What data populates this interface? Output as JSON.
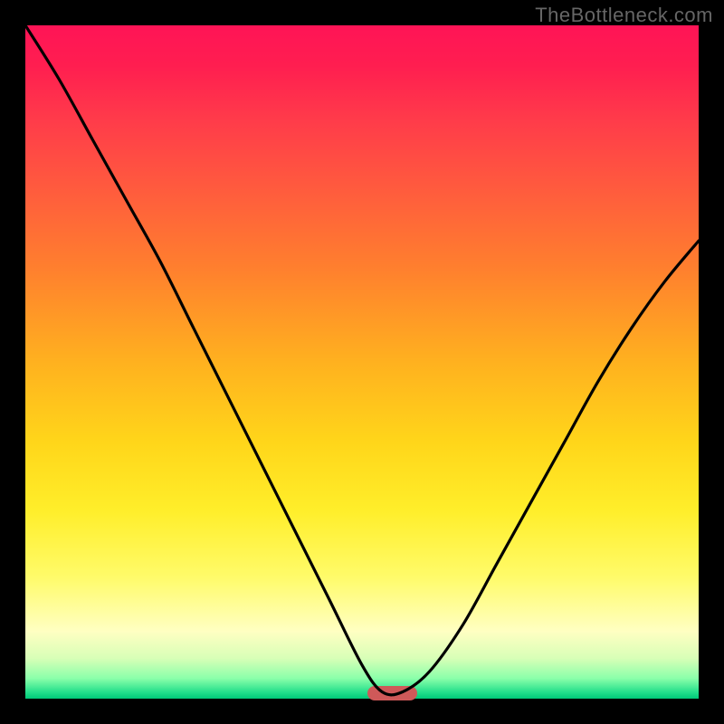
{
  "watermark": "TheBottleneck.com",
  "colors": {
    "frame_bg": "#000000",
    "marker": "#cf5959",
    "curve": "#000000"
  },
  "chart_data": {
    "type": "line",
    "title": "",
    "xlabel": "",
    "ylabel": "",
    "xlim": [
      0,
      1
    ],
    "ylim": [
      0,
      1
    ],
    "series": [
      {
        "name": "bottleneck-curve",
        "x": [
          0.0,
          0.05,
          0.1,
          0.15,
          0.2,
          0.25,
          0.3,
          0.35,
          0.4,
          0.45,
          0.5,
          0.53,
          0.56,
          0.6,
          0.65,
          0.7,
          0.75,
          0.8,
          0.85,
          0.9,
          0.95,
          1.0
        ],
        "y": [
          1.0,
          0.92,
          0.83,
          0.74,
          0.65,
          0.55,
          0.45,
          0.35,
          0.25,
          0.15,
          0.05,
          0.01,
          0.01,
          0.04,
          0.11,
          0.2,
          0.29,
          0.38,
          0.47,
          0.55,
          0.62,
          0.68
        ]
      }
    ],
    "marker": {
      "x_center": 0.545,
      "y": 0.0,
      "width_frac": 0.075
    },
    "gradient_stops": [
      {
        "pos": 0.0,
        "color": "#ff1456"
      },
      {
        "pos": 0.5,
        "color": "#ffb11f"
      },
      {
        "pos": 0.82,
        "color": "#fffb6a"
      },
      {
        "pos": 0.97,
        "color": "#8affaa"
      },
      {
        "pos": 1.0,
        "color": "#00c878"
      }
    ]
  }
}
